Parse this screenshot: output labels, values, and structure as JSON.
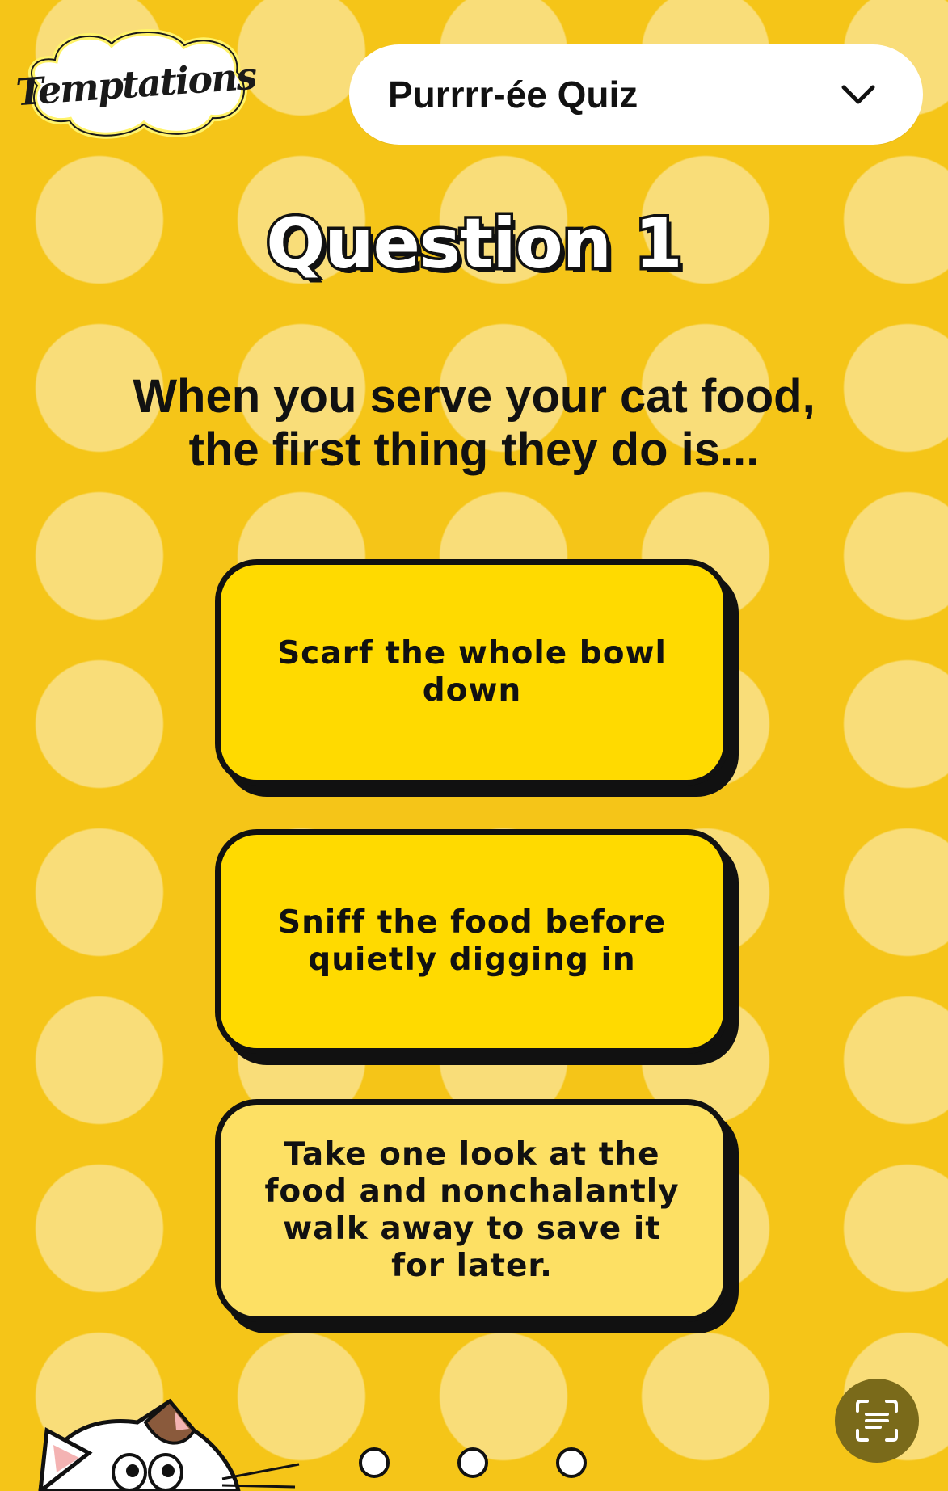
{
  "brand": {
    "logo_text": "Temptations"
  },
  "header": {
    "quiz_title": "Purrrr-ée Quiz",
    "dropdown_icon": "chevron-down-icon"
  },
  "question": {
    "number_label": "Question 1",
    "text_line1": "When you serve your cat food,",
    "text_line2": "the first thing they do is..."
  },
  "answers": [
    {
      "label": "Scarf the whole bowl down"
    },
    {
      "label": "Sniff the food before quietly digging in"
    },
    {
      "label": "Take one look at the food and nonchalantly walk away to save it for later."
    }
  ],
  "pagination": {
    "count": 3
  },
  "scan_button": {
    "icon": "text-scan-icon"
  },
  "colors": {
    "background": "#f5c518",
    "answer_fill": "#ffda00",
    "answer_fill_alt": "#fde064",
    "scan_button": "#7a6a1a"
  }
}
